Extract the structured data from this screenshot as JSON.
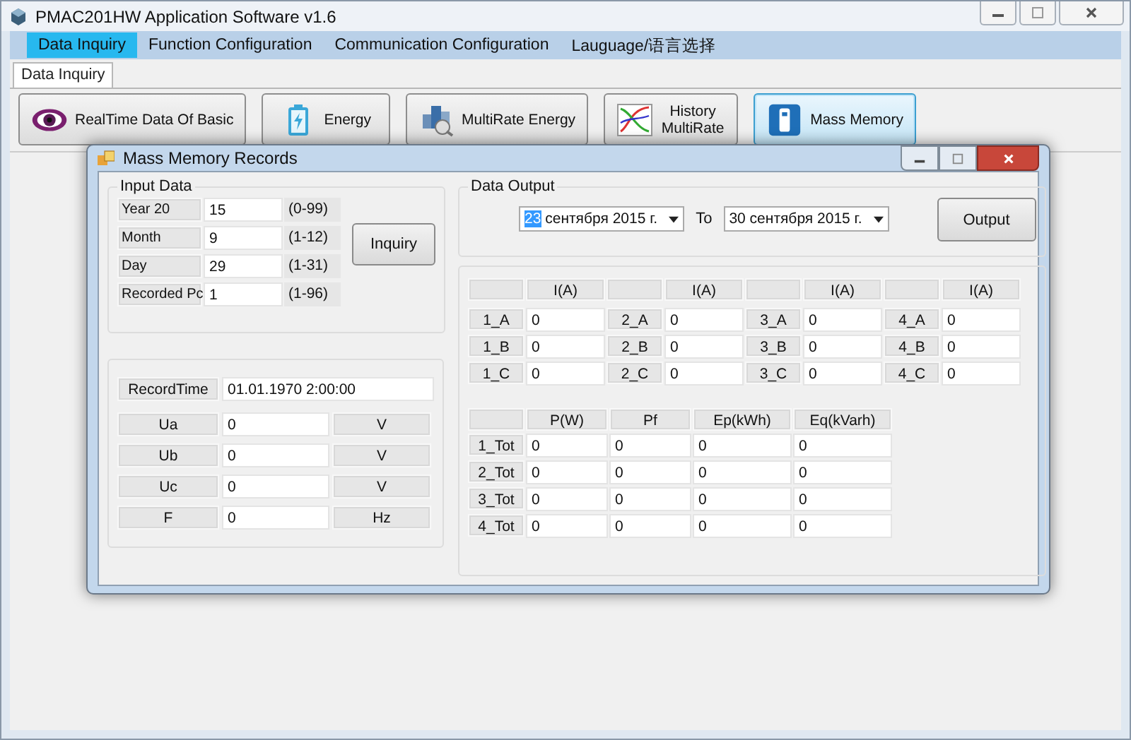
{
  "window": {
    "title": "PMAC201HW Application Software v1.6"
  },
  "menu": [
    {
      "label": "Data Inquiry",
      "selected": true
    },
    {
      "label": "Function Configuration",
      "selected": false
    },
    {
      "label": "Communication Configuration",
      "selected": false
    },
    {
      "label": "Lauguage/语言选择",
      "selected": false
    }
  ],
  "tabs": [
    {
      "label": "Data Inquiry",
      "selected": true
    }
  ],
  "toolbar": [
    {
      "label": "RealTime Data Of Basic",
      "kind": "eye",
      "selected": false
    },
    {
      "label": "Energy",
      "kind": "battery",
      "selected": false
    },
    {
      "label": "MultiRate Energy",
      "kind": "meter",
      "selected": false
    },
    {
      "label": "History MultiRate",
      "kind": "chart",
      "selected": false
    },
    {
      "label": "Mass Memory",
      "kind": "usb",
      "selected": true
    }
  ],
  "dialog": {
    "title": "Mass Memory Records",
    "input_data": {
      "title": "Input Data",
      "rows": [
        {
          "label": "Year   20",
          "value": "15",
          "range": "(0-99)"
        },
        {
          "label": "Month",
          "value": "9",
          "range": "(1-12)"
        },
        {
          "label": "Day",
          "value": "29",
          "range": "(1-31)"
        },
        {
          "label": "Recorded Pc",
          "value": "1",
          "range": "(1-96)"
        }
      ],
      "button": "Inquiry"
    },
    "record": {
      "time_label": "RecordTime",
      "time_value": "01.01.1970 2:00:00",
      "rows": [
        {
          "label": "Ua",
          "value": "0",
          "unit": "V"
        },
        {
          "label": "Ub",
          "value": "0",
          "unit": "V"
        },
        {
          "label": "Uc",
          "value": "0",
          "unit": "V"
        },
        {
          "label": "F",
          "value": "0",
          "unit": "Hz"
        }
      ]
    },
    "data_output": {
      "title": "Data Output",
      "from_day": "23",
      "from_rest": "сентября 2015 г.",
      "to_label": "To",
      "to": "30 сентября 2015 г.",
      "button": "Output"
    },
    "currents": [
      {
        "header": "I(A)",
        "rows": [
          {
            "label": "1_A",
            "value": "0"
          },
          {
            "label": "1_B",
            "value": "0"
          },
          {
            "label": "1_C",
            "value": "0"
          }
        ]
      },
      {
        "header": "I(A)",
        "rows": [
          {
            "label": "2_A",
            "value": "0"
          },
          {
            "label": "2_B",
            "value": "0"
          },
          {
            "label": "2_C",
            "value": "0"
          }
        ]
      },
      {
        "header": "I(A)",
        "rows": [
          {
            "label": "3_A",
            "value": "0"
          },
          {
            "label": "3_B",
            "value": "0"
          },
          {
            "label": "3_C",
            "value": "0"
          }
        ]
      },
      {
        "header": "I(A)",
        "rows": [
          {
            "label": "4_A",
            "value": "0"
          },
          {
            "label": "4_B",
            "value": "0"
          },
          {
            "label": "4_C",
            "value": "0"
          }
        ]
      }
    ],
    "power": {
      "columns": [
        "P(W)",
        "Pf",
        "Ep(kWh)",
        "Eq(kVarh)"
      ],
      "rows": [
        {
          "label": "1_Tot",
          "values": [
            "0",
            "0",
            "0",
            "0"
          ]
        },
        {
          "label": "2_Tot",
          "values": [
            "0",
            "0",
            "0",
            "0"
          ]
        },
        {
          "label": "3_Tot",
          "values": [
            "0",
            "0",
            "0",
            "0"
          ]
        },
        {
          "label": "4_Tot",
          "values": [
            "0",
            "0",
            "0",
            "0"
          ]
        }
      ]
    }
  }
}
